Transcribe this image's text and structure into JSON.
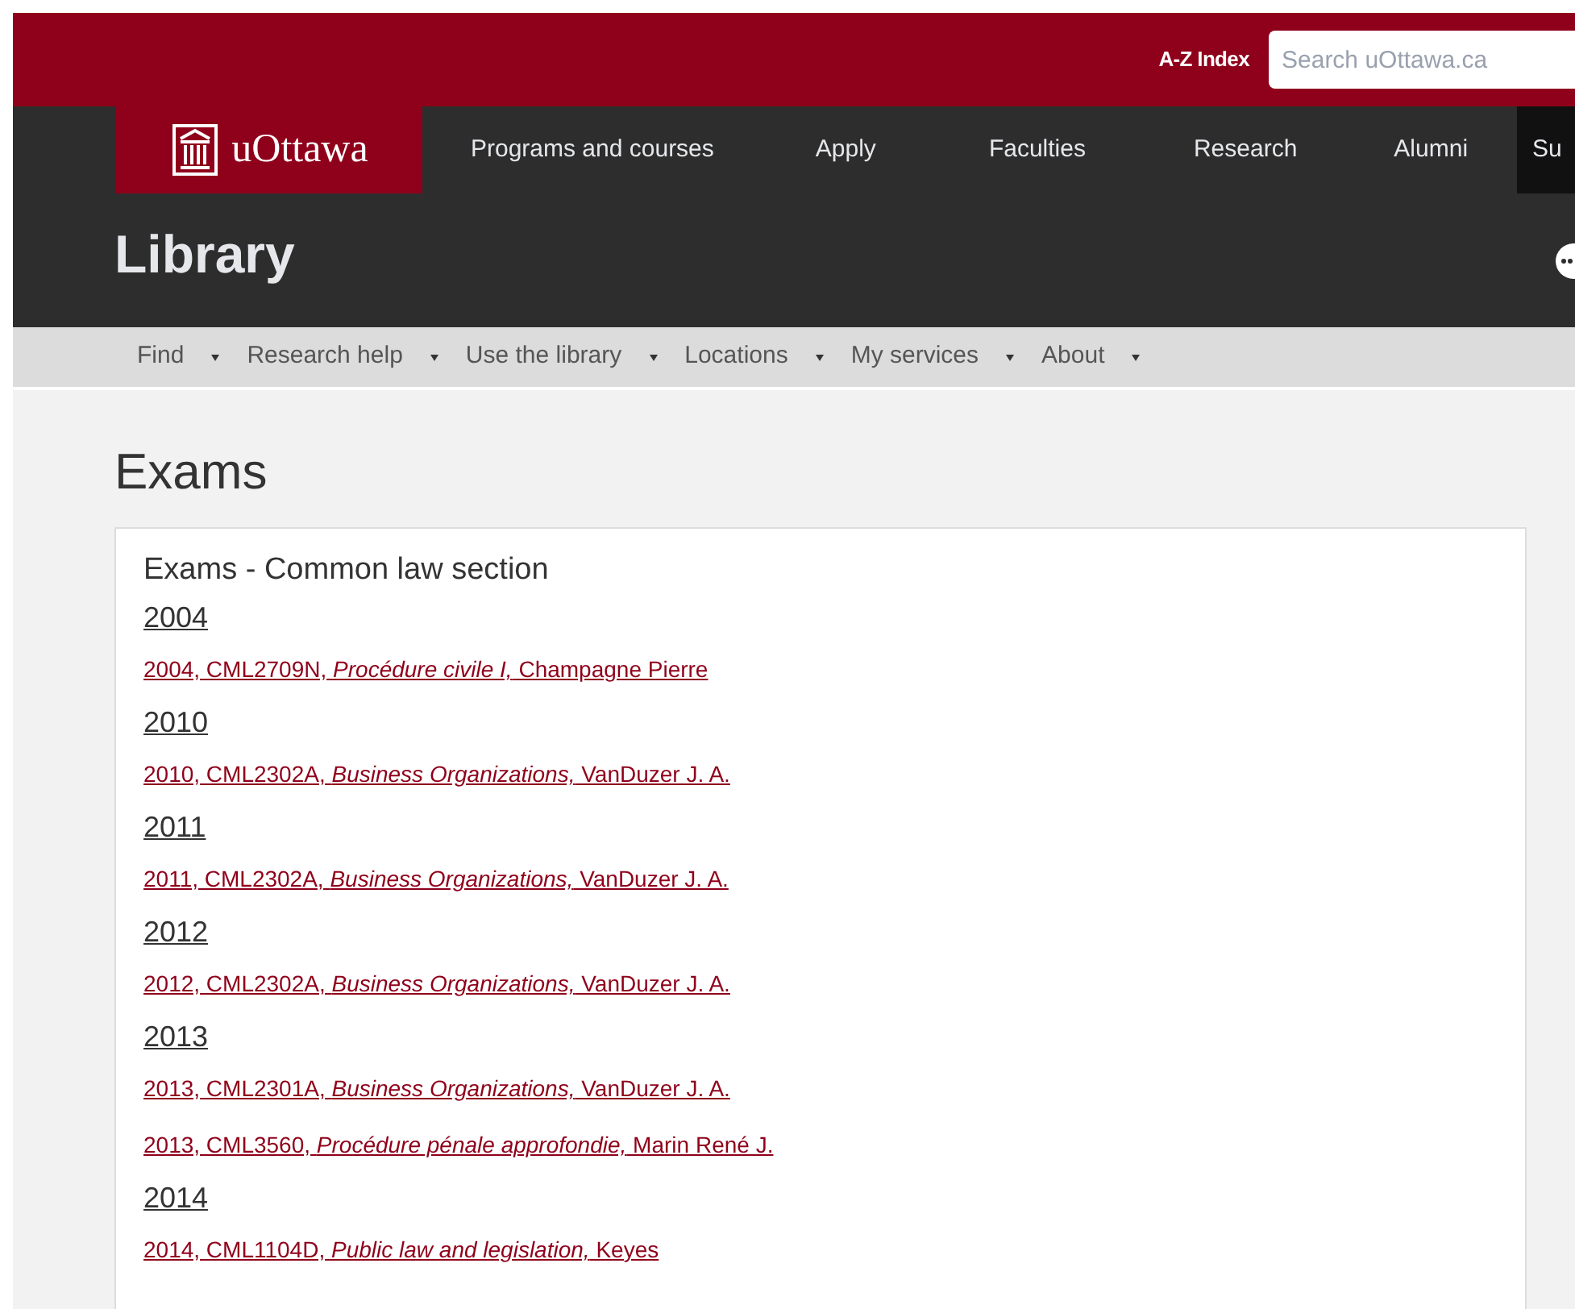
{
  "utility": {
    "az_index": "A-Z Index",
    "search": {
      "placeholder": "Search uOttawa.ca"
    }
  },
  "brand": {
    "name": "uOttawa"
  },
  "main_nav": [
    {
      "label": "Programs and courses",
      "selected": false
    },
    {
      "label": "Apply",
      "selected": false
    },
    {
      "label": "Faculties",
      "selected": false
    },
    {
      "label": "Research",
      "selected": false
    },
    {
      "label": "Alumni",
      "selected": false
    },
    {
      "label": "Su",
      "selected": true
    }
  ],
  "site_title": "Library",
  "sub_nav": [
    "Find",
    "Research help",
    "Use the library",
    "Locations",
    "My services",
    "About"
  ],
  "page_title": "Exams",
  "card": {
    "title": "Exams - Common law section",
    "sections": [
      {
        "year": "2004",
        "exams": [
          "2004, CML2709N, *Procédure civile I,* Champagne Pierre"
        ]
      },
      {
        "year": "2010",
        "exams": [
          "2010, CML2302A, *Business Organizations,* VanDuzer J. A."
        ]
      },
      {
        "year": "2011",
        "exams": [
          "2011, CML2302A, *Business Organizations,* VanDuzer J. A."
        ]
      },
      {
        "year": "2012",
        "exams": [
          "2012, CML2302A, *Business Organizations,* VanDuzer J. A."
        ]
      },
      {
        "year": "2013",
        "exams": [
          "2013, CML2301A, *Business Organizations,* VanDuzer J. A.",
          "2013, CML3560, *Procédure pénale approfondie,* Marin René J."
        ]
      },
      {
        "year": "2014",
        "exams": [
          "2014, CML1104D, *Public law and legislation,* Keyes"
        ]
      }
    ]
  }
}
